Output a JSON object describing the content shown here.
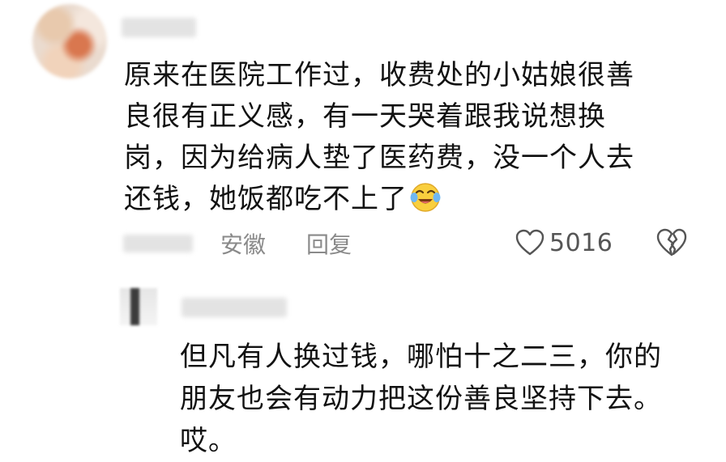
{
  "comment": {
    "text_lines": [
      "原来在医院工作过，收费处的小姑娘很善",
      "良很有正义感，有一天哭着跟我说想换",
      "岗，因为给病人垫了医药费，没一个人去",
      "还钱，她饭都吃不上了"
    ],
    "emoji": "crying-laughing-emoji",
    "location": "安徽",
    "reply_label": "回复",
    "like_count": "5016",
    "like_icon": "heart-outline-icon",
    "dislike_icon": "broken-heart-icon"
  },
  "reply": {
    "text_lines": [
      "但凡有人换过钱，哪怕十之二三，你的",
      "朋友也会有动力把这份善良坚持下去。",
      "哎。"
    ]
  },
  "colors": {
    "text": "#121212",
    "meta": "#8a8a8a",
    "background": "#ffffff"
  }
}
